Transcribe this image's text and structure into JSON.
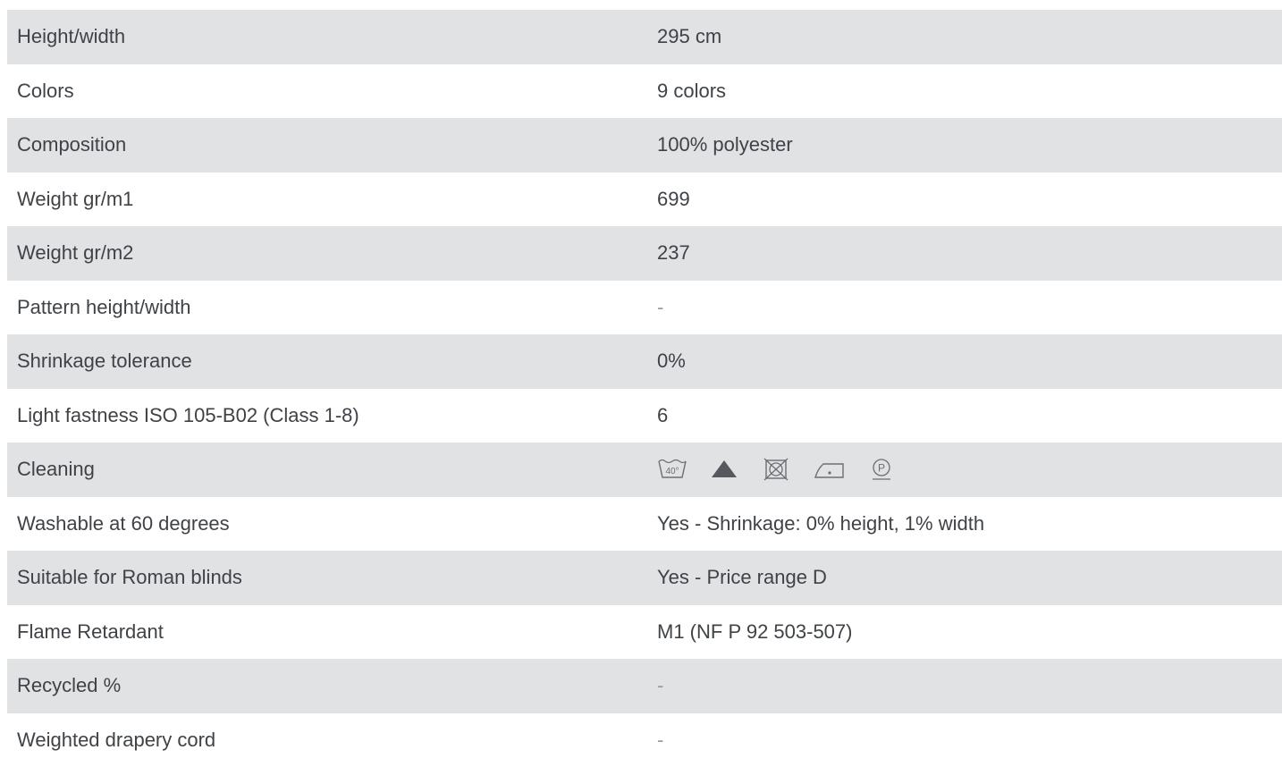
{
  "specs": {
    "rows": [
      {
        "label": "Height/width",
        "value": "295 cm"
      },
      {
        "label": "Colors",
        "value": "9 colors"
      },
      {
        "label": "Composition",
        "value": "100% polyester"
      },
      {
        "label": "Weight gr/m1",
        "value": "699"
      },
      {
        "label": "Weight gr/m2",
        "value": "237"
      },
      {
        "label": "Pattern height/width",
        "value": "-"
      },
      {
        "label": "Shrinkage tolerance",
        "value": "0%"
      },
      {
        "label": "Light fastness ISO 105-B02 (Class 1-8)",
        "value": "6"
      },
      {
        "label": "Cleaning",
        "icons": [
          "wash-40-icon",
          "bleach-triangle-icon",
          "do-not-tumble-dry-icon",
          "iron-icon",
          "dry-clean-p-icon"
        ],
        "wash_temp": "40°",
        "dry_clean_letter": "P"
      },
      {
        "label": "Washable at 60 degrees",
        "value": "Yes - Shrinkage: 0% height, 1% width"
      },
      {
        "label": "Suitable for Roman blinds",
        "value": "Yes - Price range D"
      },
      {
        "label": "Flame Retardant",
        "value": "M1 (NF P 92 503-507)"
      },
      {
        "label": "Recycled %",
        "value": "-"
      },
      {
        "label": "Weighted drapery cord",
        "value": "-"
      }
    ]
  },
  "colors": {
    "shaded_row": "#e1e2e4",
    "text": "#3f4247",
    "icon": "#6b6e73"
  }
}
